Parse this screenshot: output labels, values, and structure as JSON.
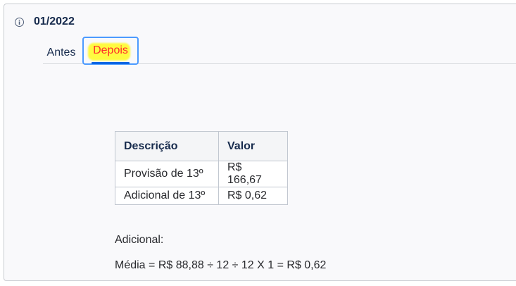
{
  "header": {
    "title": "01/2022"
  },
  "tabs": [
    {
      "label": "Antes",
      "selected": false
    },
    {
      "label": "Depois",
      "selected": true,
      "highlight_color": "#fffa40",
      "text_color": "#ff2b2b"
    }
  ],
  "table": {
    "headers": [
      "Descrição",
      "Valor"
    ],
    "rows": [
      [
        "Provisão de 13º",
        "R$ 166,67"
      ],
      [
        "Adicional de 13º",
        "R$ 0,62"
      ]
    ]
  },
  "notes": {
    "line1": "Adicional:",
    "line2": "Média = R$ 88,88 ÷ 12 ÷ 12 X 1 = R$ 0,62"
  },
  "colors": {
    "accent": "#4c9aff",
    "tab_underline": "#0c66e4"
  },
  "icons": {
    "header_icon": "info-icon"
  }
}
